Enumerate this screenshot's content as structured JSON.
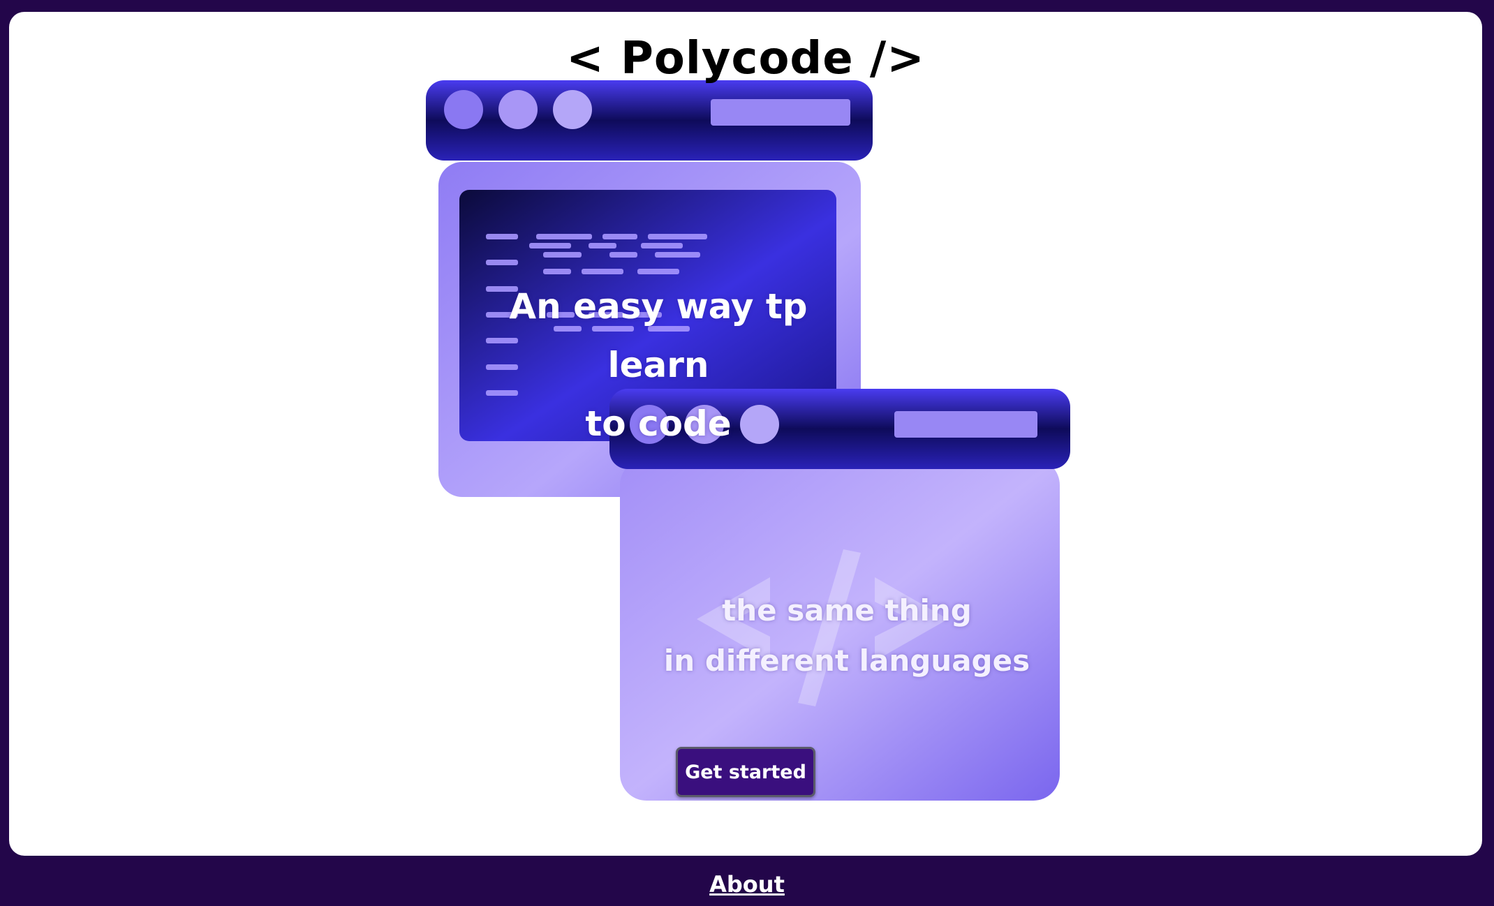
{
  "brand": {
    "logo_text": "< Polycode />"
  },
  "hero": {
    "line1": "An easy way tp learn",
    "line2": "to code",
    "line3": "the same thing",
    "line4": "in different languages"
  },
  "cta": {
    "label": "Get started"
  },
  "footer": {
    "about_label": "About"
  },
  "colors": {
    "background": "#23064a",
    "card": "#ffffff",
    "accent_dark": "#3a0f7e",
    "accent_blue": "#3c2ee6",
    "accent_violet": "#9a86f5"
  },
  "icons": [
    "browser-window-code-lines-illustration",
    "browser-window-code-tag-illustration"
  ]
}
